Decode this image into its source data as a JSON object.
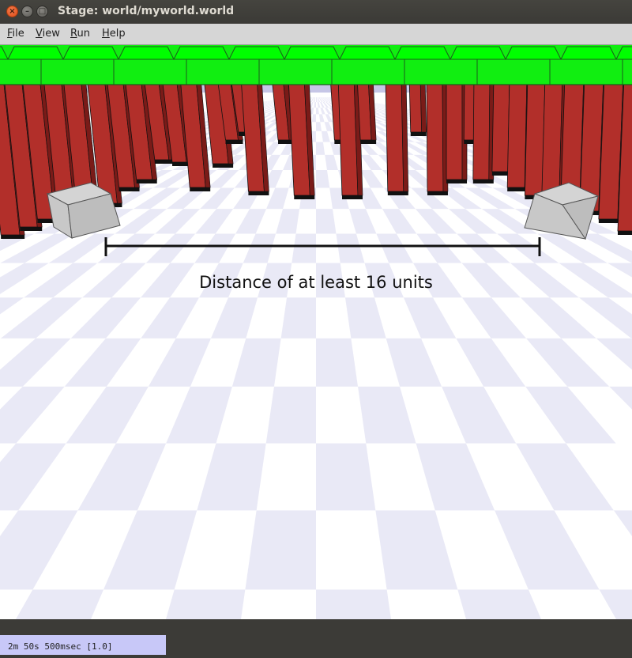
{
  "window": {
    "title": "Stage: world/myworld.world",
    "close_glyph": "×",
    "minimize_glyph": "–",
    "maximize_glyph": "□"
  },
  "menu": {
    "items": [
      {
        "mnemonic": "F",
        "rest": "ile"
      },
      {
        "mnemonic": "V",
        "rest": "iew"
      },
      {
        "mnemonic": "R",
        "rest": "un"
      },
      {
        "mnemonic": "H",
        "rest": "elp"
      }
    ]
  },
  "scene": {
    "annotation": "Distance of at least 16 units",
    "colors": {
      "floor_light": "#ffffff",
      "floor_dark": "#e9e9f6",
      "sky": "#c6c6e6",
      "wall_top": "#00ff00",
      "wall_front": "#11ee11",
      "pillar": "#b22f2a",
      "pillar_dark": "#7a1b18",
      "robot_box": "#c8c8c8"
    }
  },
  "status": {
    "time": "2m 50s 500msec [1.0]"
  }
}
